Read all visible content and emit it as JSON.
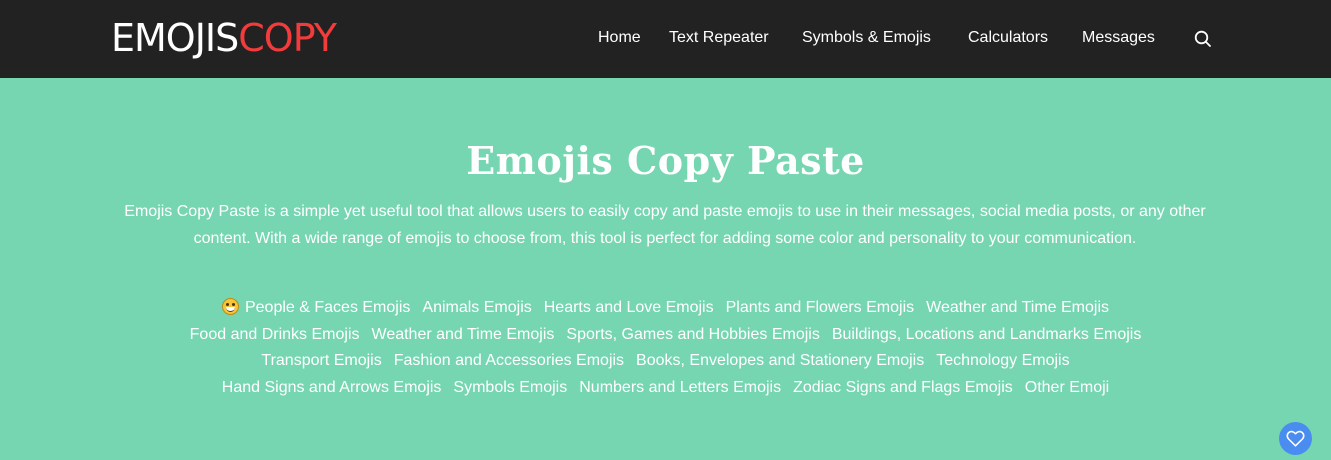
{
  "brand": {
    "logo_part1": "EMOJIS",
    "logo_part2": "COPY",
    "accent": "#f23b3b"
  },
  "nav": {
    "items": [
      {
        "label": "Home"
      },
      {
        "label": "Text Repeater"
      },
      {
        "label": "Symbols & Emojis"
      },
      {
        "label": "Calculators"
      },
      {
        "label": "Messages"
      }
    ],
    "search_icon": "search-icon"
  },
  "hero": {
    "title": "Emojis Copy Paste",
    "description": "Emojis Copy Paste is a simple yet useful tool that allows users to easily copy and paste emojis to use in their messages, social media posts, or any other content. With a wide range of emojis to choose from, this tool is perfect for adding some color and personality to your communication.",
    "background": "#76d6b1"
  },
  "categories": {
    "rows": [
      [
        "People & Faces Emojis",
        "Animals Emojis",
        "Hearts and Love Emojis",
        "Plants and Flowers Emojis",
        "Weather and Time Emojis"
      ],
      [
        "Food and Drinks Emojis",
        "Weather and Time Emojis",
        "Sports, Games and Hobbies Emojis",
        "Buildings, Locations and Landmarks Emojis"
      ],
      [
        "Transport Emojis",
        "Fashion and Accessories Emojis",
        "Books, Envelopes and Stationery Emojis",
        "Technology Emojis"
      ],
      [
        "Hand Signs and Arrows Emojis",
        "Symbols Emojis",
        "Numbers and Letters Emojis",
        "Zodiac Signs and Flags Emojis",
        "Other Emoji"
      ]
    ],
    "first_item_icon": "grinning-face-icon"
  },
  "floating": {
    "icon": "heart-icon",
    "color": "#4a8cf0"
  }
}
